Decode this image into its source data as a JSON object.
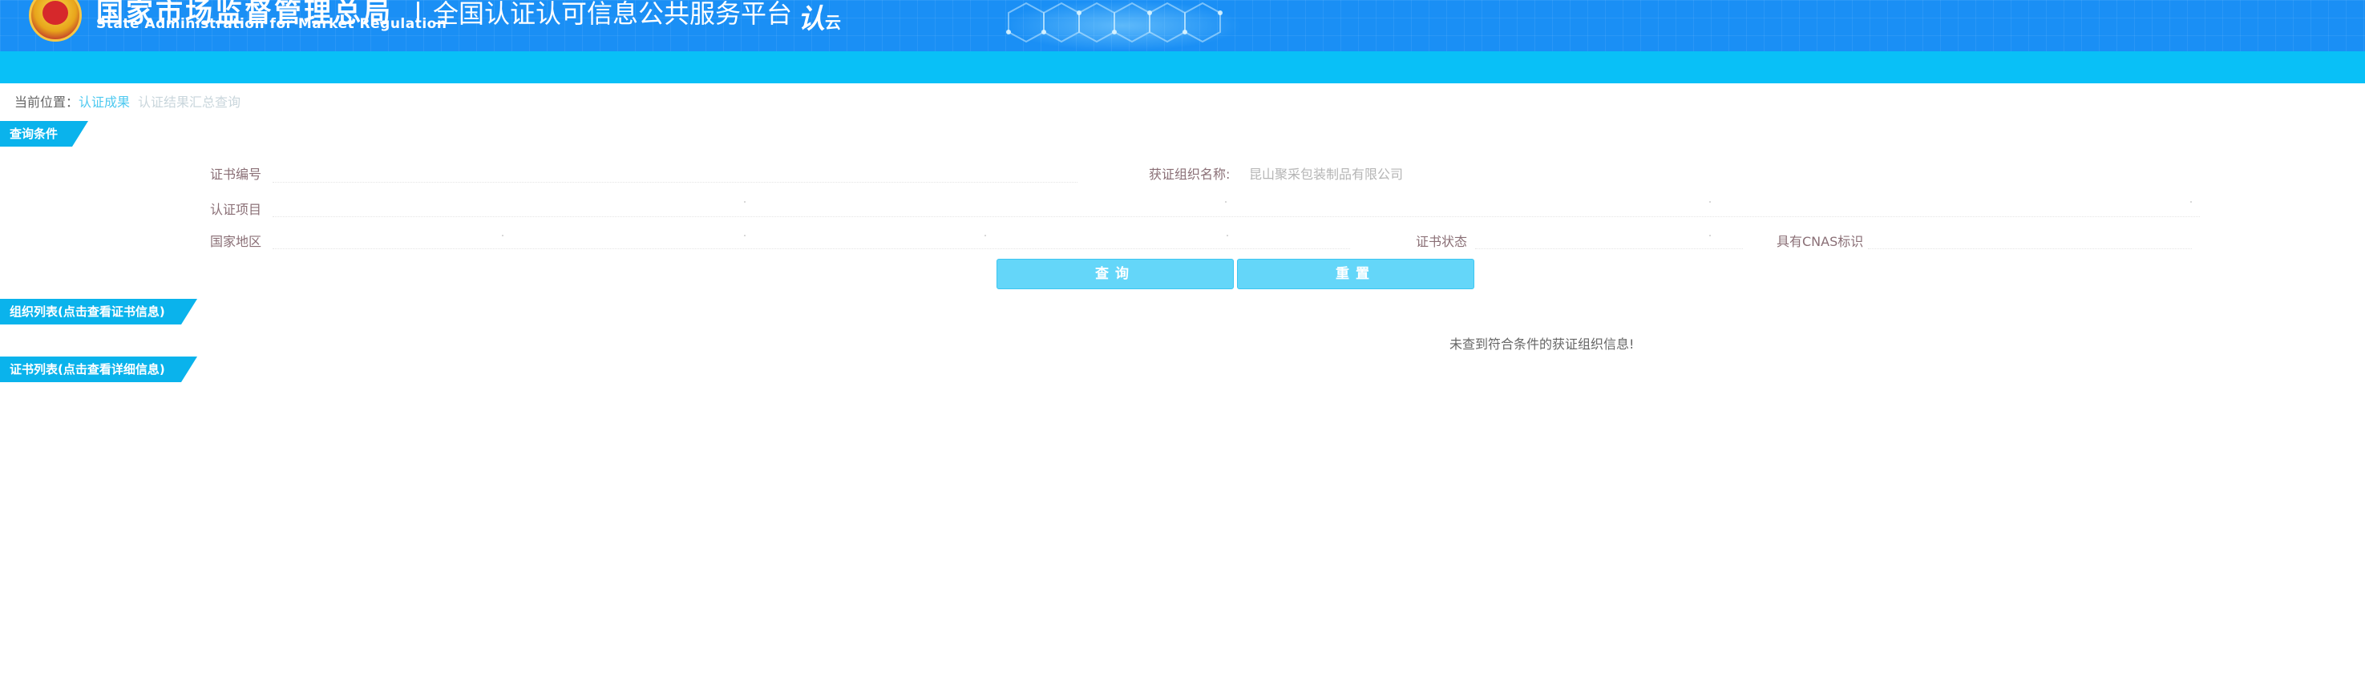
{
  "header": {
    "agency_cn": "国家市场监督管理总局",
    "agency_en": "State Administration  for  Market Regulation",
    "platform_title": "全国认证认可信息公共服务平台",
    "logo_main": "认",
    "logo_sub": "云"
  },
  "breadcrumb": {
    "prefix": "当前位置：",
    "link": "认证成果",
    "current": "认证结果汇总查询"
  },
  "sections": {
    "query": "查询条件",
    "org_list": "组织列表(点击查看证书信息)",
    "cert_list": "证书列表(点击查看详细信息)"
  },
  "form": {
    "cert_no_label": "证书编号",
    "cert_no_value": "",
    "org_name_label": "获证组织名称:",
    "org_name_value": "昆山聚采包装制品有限公司",
    "project_label": "认证项目",
    "country_label": "国家地区",
    "status_label": "证书状态",
    "cnas_label": "具有CNAS标识"
  },
  "buttons": {
    "search": "查询",
    "reset": "重置"
  },
  "results": {
    "empty_message": "未查到符合条件的获证组织信息!"
  },
  "colors": {
    "header_blue": "#1a8ff5",
    "nav_cyan": "#09c0f7",
    "tab_blue": "#0ab3ec",
    "button_cyan": "#64d6f9",
    "link_cyan": "#4ec9f0"
  }
}
